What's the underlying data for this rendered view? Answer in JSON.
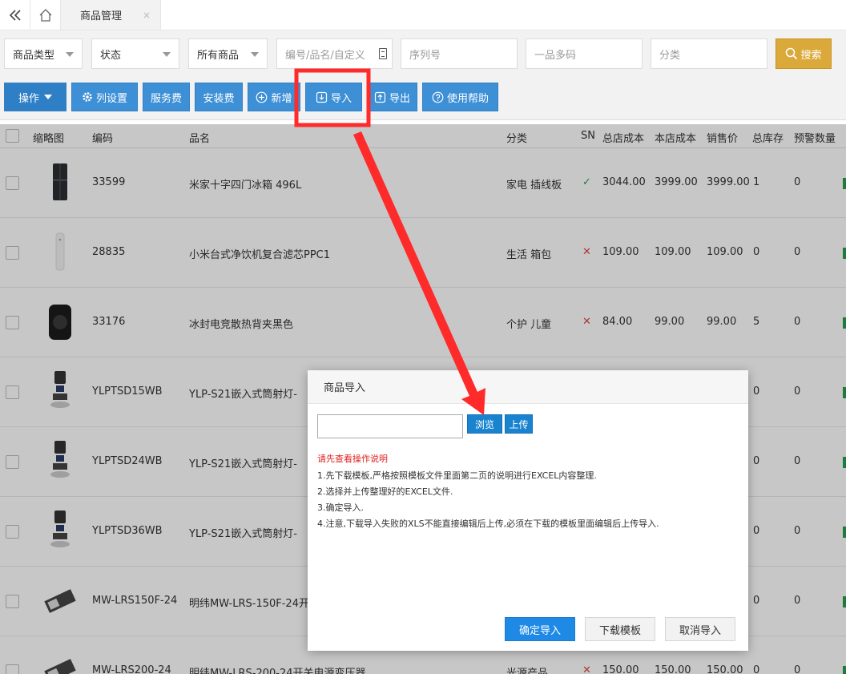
{
  "tabs": {
    "page_title": "商品管理",
    "close": "×"
  },
  "filters": {
    "type": "商品类型",
    "status": "状态",
    "scope": "所有商品",
    "code_placeholder": "编号/品名/自定义",
    "serial_placeholder": "序列号",
    "barcode_placeholder": "一品多码",
    "category_placeholder": "分类",
    "search_label": "搜索"
  },
  "toolbar": {
    "operate": "操作",
    "columns": "列设置",
    "service_fee": "服务费",
    "install_fee": "安装费",
    "add": "新增",
    "import": "导入",
    "export": "导出",
    "help": "使用帮助"
  },
  "table": {
    "headers": [
      "缩略图",
      "编码",
      "品名",
      "分类",
      "SN",
      "总店成本",
      "本店成本",
      "销售价",
      "总库存",
      "预警数量"
    ],
    "rows": [
      {
        "code": "33599",
        "name": "米家十字四门冰箱 496L",
        "category": "家电 插线板",
        "sn": "✓",
        "total_cost": "3044.00",
        "store_cost": "3999.00",
        "price": "3999.00",
        "stock": "1",
        "alert": "0"
      },
      {
        "code": "28835",
        "name": "小米台式净饮机复合滤芯PPC1",
        "category": "生活 箱包",
        "sn": "✕",
        "total_cost": "109.00",
        "store_cost": "109.00",
        "price": "109.00",
        "stock": "0",
        "alert": "0"
      },
      {
        "code": "33176",
        "name": "冰封电竞散热背夹黑色",
        "category": "个护 儿童",
        "sn": "✕",
        "total_cost": "84.00",
        "store_cost": "99.00",
        "price": "99.00",
        "stock": "5",
        "alert": "0"
      },
      {
        "code": "YLPTSD15WB",
        "name": "YLP-S21嵌入式筒射灯-",
        "category": "",
        "sn": "",
        "total_cost": "",
        "store_cost": "",
        "price": "",
        "stock": "0",
        "alert": "0"
      },
      {
        "code": "YLPTSD24WB",
        "name": "YLP-S21嵌入式筒射灯-",
        "category": "",
        "sn": "",
        "total_cost": "",
        "store_cost": "",
        "price": "",
        "stock": "0",
        "alert": "0"
      },
      {
        "code": "YLPTSD36WB",
        "name": "YLP-S21嵌入式筒射灯-",
        "category": "",
        "sn": "",
        "total_cost": "",
        "store_cost": "",
        "price": "",
        "stock": "0",
        "alert": "0"
      },
      {
        "code": "MW-LRS150F-24",
        "name": "明纬MW-LRS-150F-24开",
        "category": "",
        "sn": "",
        "total_cost": "",
        "store_cost": "",
        "price": "",
        "stock": "0",
        "alert": "0"
      },
      {
        "code": "MW-LRS200-24",
        "name": "明纬MW-LRS-200-24开关电源变压器",
        "category": "光源产品",
        "sn": "✕",
        "total_cost": "150.00",
        "store_cost": "150.00",
        "price": "150.00",
        "stock": "0",
        "alert": "0"
      }
    ]
  },
  "modal": {
    "title": "商品导入",
    "browse": "浏览",
    "upload": "上传",
    "tip_red": "请先查看操作说明",
    "tips": [
      "1.先下载模板,严格按照模板文件里面第二页的说明进行EXCEL内容整理.",
      "2.选择并上传整理好的EXCEL文件.",
      "3.确定导入.",
      "4.注意,下载导入失败的XLS不能直接编辑后上传,必须在下载的模板里面编辑后上传导入."
    ],
    "confirm": "确定导入",
    "download": "下载模板",
    "cancel": "取消导入"
  },
  "colors": {
    "primary": "#3d8fd6",
    "search": "#dba83a",
    "annotation": "#ff2a2a"
  }
}
